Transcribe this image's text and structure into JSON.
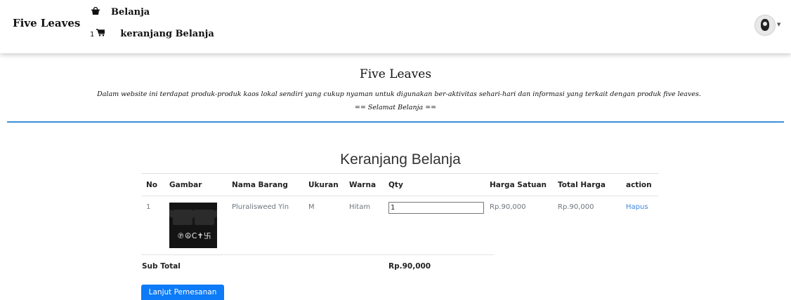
{
  "navbar": {
    "brand": "Five Leaves",
    "belanja_label": "Belanja",
    "cart_count": "1",
    "cart_label": "keranjang Belanja",
    "icons": {
      "belanja": "shopping-bag-icon",
      "cart": "cart-icon",
      "avatar": "user-avatar-icon",
      "caret": "caret-down-icon"
    }
  },
  "hero": {
    "title": "Five Leaves",
    "description": "Dalam website ini terdapat produk-produk kaos lokal sendiri yang cukup nyaman untuk digunakan ber-aktivitas sehari-hari dan informasi yang terkait dengan produk five leaves.",
    "greeting": "== Selamat Belanja =="
  },
  "cart": {
    "title": "Keranjang Belanja",
    "columns": [
      "No",
      "Gambar",
      "Nama Barang",
      "Ukuran",
      "Warna",
      "Qty",
      "Harga Satuan",
      "Total Harga",
      "action"
    ],
    "rows": [
      {
        "no": "1",
        "image_text": "℗☮C✝卐",
        "name": "Pluralisweed Yin",
        "size": "M",
        "color": "Hitam",
        "qty": "1",
        "unit_price": "Rp.90,000",
        "total_price": "Rp.90,000",
        "action": "Hapus"
      }
    ],
    "subtotal_label": "Sub Total",
    "subtotal_value": "Rp.90,000",
    "checkout_button": "Lanjut Pemesanan"
  },
  "colors": {
    "accent": "#3d8ed8",
    "button": "#0d7bf7",
    "link": "#3b86e0"
  }
}
